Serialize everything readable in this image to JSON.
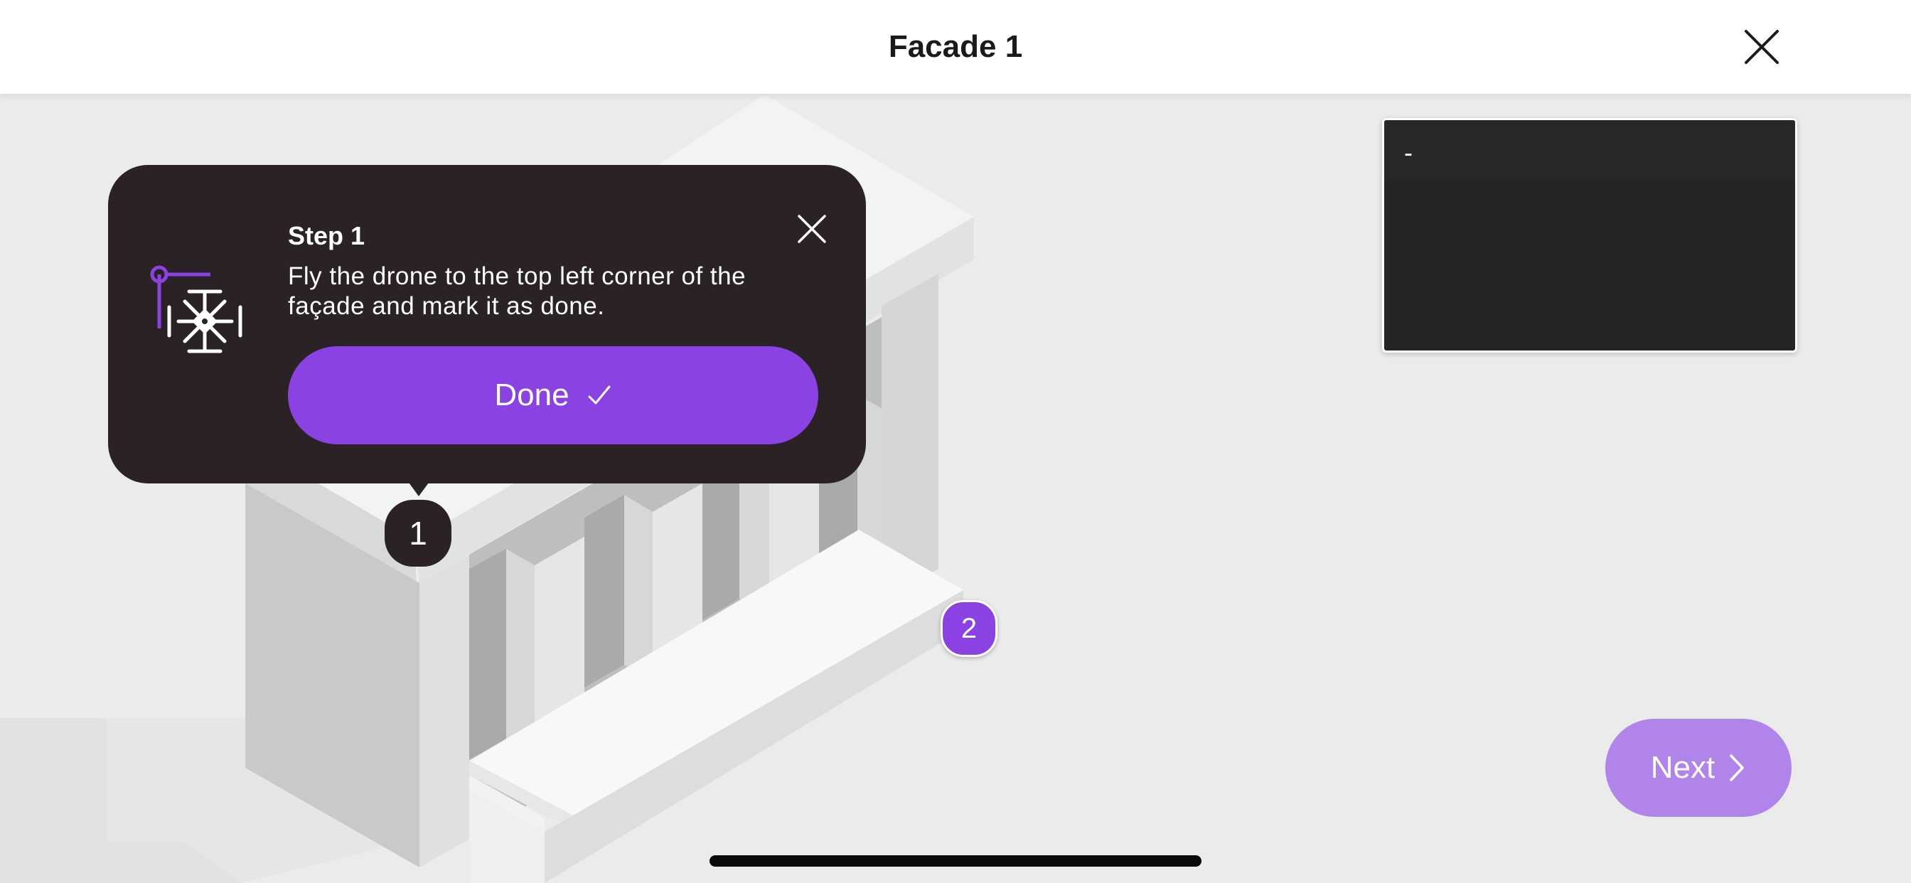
{
  "header": {
    "title": "Facade 1",
    "close_icon": "close-icon"
  },
  "step_popup": {
    "title": "Step 1",
    "instruction": "Fly the drone to the top left corner of the façade and mark it as done.",
    "done_label": "Done",
    "done_icon": "checkmark-icon",
    "illustration_icon": "drone-corner-icon",
    "close_icon": "close-icon"
  },
  "markers": {
    "marker_1": "1",
    "marker_2": "2"
  },
  "video_panel": {
    "text": "-"
  },
  "footer": {
    "next_label": "Next",
    "next_icon": "chevron-right-icon"
  },
  "colors": {
    "accent": "#8a42e2",
    "accent_disabled": "#b084e8",
    "popup_background": "#2a2224",
    "background": "#ebebeb"
  }
}
